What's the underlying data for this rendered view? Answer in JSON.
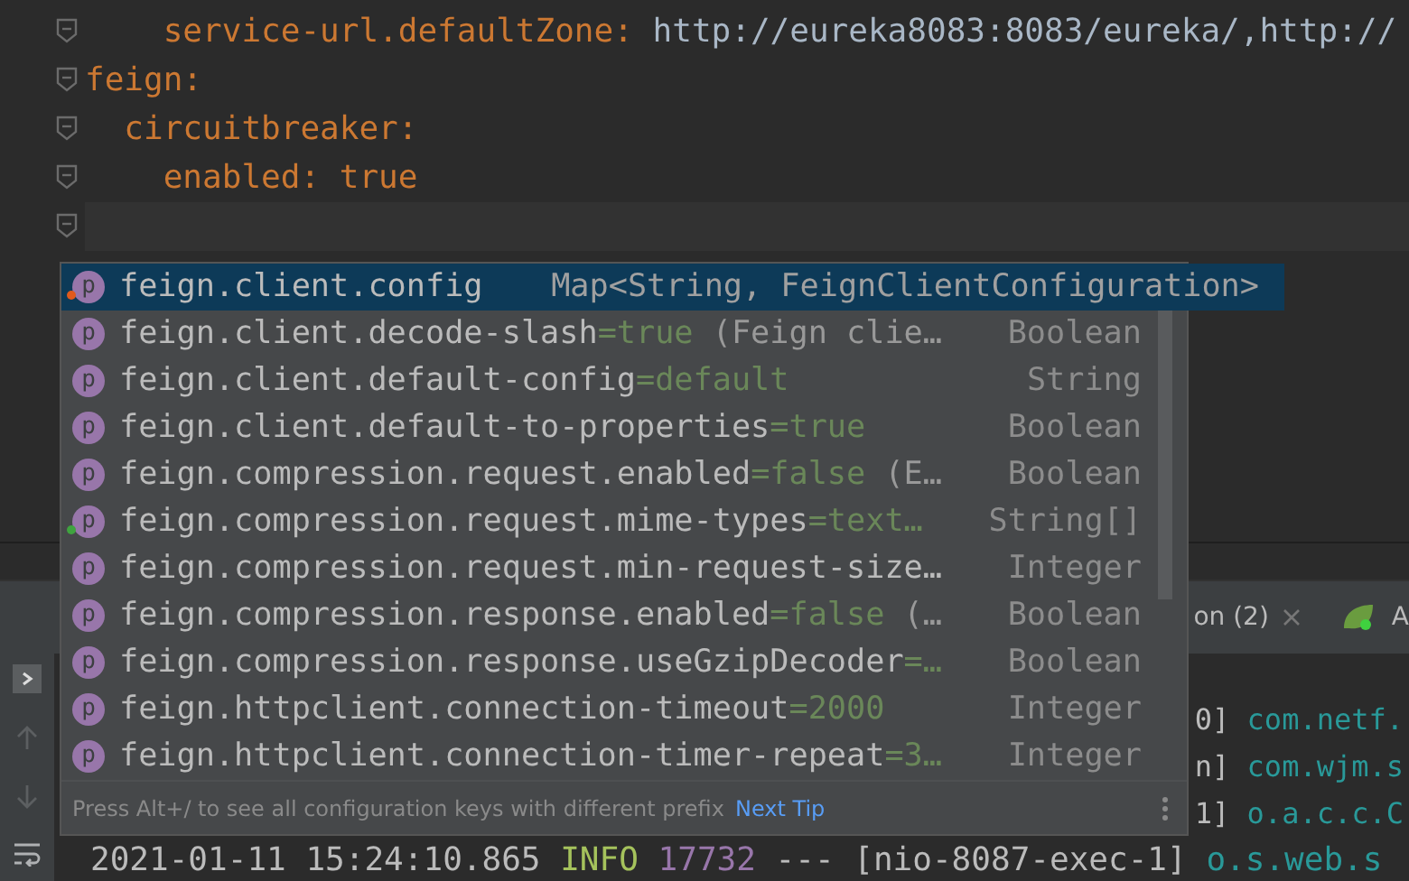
{
  "editor": {
    "yaml": [
      {
        "children": [
          {
            "children": [
              {
                "key": "service-url.defaultZone:",
                "value": "http://eureka8083:8083/eureka/,http://",
                "color": "#a9b7c6"
              }
            ]
          }
        ]
      },
      {
        "key": "feign:",
        "children": [
          {
            "key": "circuitbreaker:",
            "children": [
              {
                "key": "enabled:",
                "value": "true",
                "color": "#cc7832"
              }
            ]
          }
        ]
      }
    ]
  },
  "completion_popup": {
    "items": [
      {
        "icon_letter": "p",
        "name": "feign.client.config",
        "type": "Map<String, FeignClientConfiguration>",
        "selected": true,
        "color": "#e05a1c"
      },
      {
        "icon_letter": "p",
        "name": "feign.client.decode-slash",
        "default": "=true",
        "note": " (Feign clie…",
        "type": "Boolean",
        "selected": false
      },
      {
        "icon_letter": "p",
        "name": "feign.client.default-config",
        "default": "=default",
        "type": "String",
        "selected": false
      },
      {
        "icon_letter": "p",
        "name": "feign.client.default-to-properties",
        "default": "=true",
        "type": "Boolean",
        "selected": false
      },
      {
        "icon_letter": "p",
        "name": "feign.compression.request.enabled",
        "default": "=false",
        "note": " (E…",
        "type": "Boolean",
        "selected": false
      },
      {
        "icon_letter": "p",
        "name": "feign.compression.request.mime-types",
        "default": "=text…",
        "type": "String[]",
        "selected": false,
        "color": "#3fa33f"
      },
      {
        "icon_letter": "p",
        "name": "feign.compression.request.min-request-size…",
        "type": "Integer",
        "selected": false
      },
      {
        "icon_letter": "p",
        "name": "feign.compression.response.enabled",
        "default": "=false",
        "note": " (…",
        "type": "Boolean",
        "selected": false
      },
      {
        "icon_letter": "p",
        "name": "feign.compression.response.useGzipDecoder",
        "default": "=…",
        "type": "Boolean",
        "selected": false
      },
      {
        "icon_letter": "p",
        "name": "feign.httpclient.connection-timeout",
        "default": "=2000",
        "type": "Integer",
        "selected": false
      },
      {
        "icon_letter": "p",
        "name": "feign.httpclient.connection-timer-repeat",
        "default": "=3…",
        "type": "Integer",
        "selected": false
      }
    ],
    "hint": "Press Alt+/ to see all configuration keys with different prefix",
    "next_tip": "Next Tip"
  },
  "bottom_panel": {
    "tabs": [
      {
        "label": "on (2)",
        "closable": true
      },
      {
        "label": "A",
        "closable": false
      }
    ],
    "console_lines": [
      {
        "parts": [
          {
            "text": "0]",
            "kind": "plain"
          },
          {
            "text": "com.netf.",
            "kind": "logger"
          }
        ]
      },
      {
        "parts": [
          {
            "text": "n]",
            "kind": "plain"
          },
          {
            "text": "com.wjm.s",
            "kind": "logger"
          }
        ]
      },
      {
        "parts": [
          {
            "text": "1]",
            "kind": "plain"
          },
          {
            "text": "o.a.c.c.C",
            "kind": "logger"
          }
        ]
      },
      {
        "parts": [
          {
            "text": "2021-01-11 15:24:10.865",
            "kind": "plain"
          },
          {
            "text": " INFO",
            "kind": "level"
          },
          {
            "text": "17732",
            "kind": "pid"
          },
          {
            "text": "---",
            "kind": "plain"
          },
          {
            "text": "[nio-8087-exec-1]",
            "kind": "plain"
          },
          {
            "text": "o.s.web.s",
            "kind": "logger"
          }
        ]
      }
    ]
  }
}
